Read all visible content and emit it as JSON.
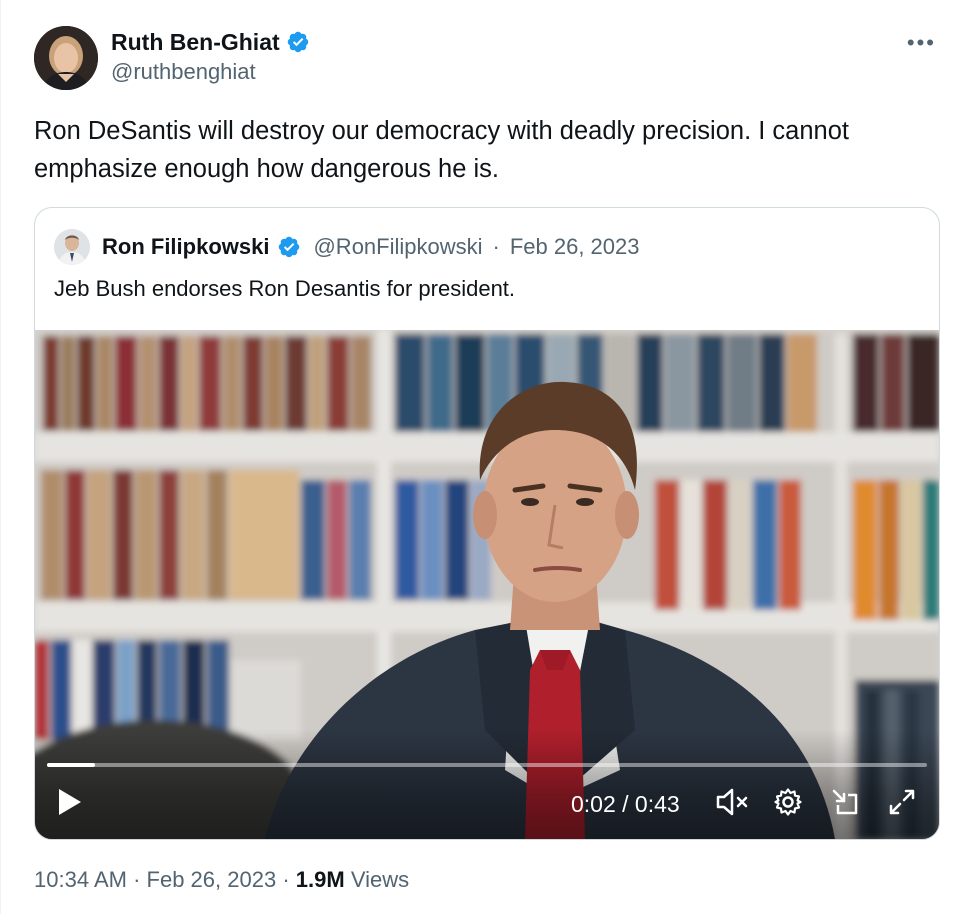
{
  "author": {
    "name": "Ruth Ben-Ghiat",
    "handle": "@ruthbenghiat",
    "verified": true
  },
  "more_label": "•••",
  "tweet_text": "Ron DeSantis will destroy our democracy with deadly precision. I cannot emphasize enough how dangerous he is.",
  "quoted": {
    "name": "Ron Filipkowski",
    "handle": "@RonFilipkowski",
    "separator": "·",
    "date": "Feb 26, 2023",
    "text": "Jeb Bush endorses Ron Desantis for president."
  },
  "video": {
    "time": "0:02 / 0:43",
    "progress": 0.055
  },
  "footer": {
    "time": "10:34 AM",
    "separator": "·",
    "date": "Feb 26, 2023",
    "views_count": "1.9M",
    "views_label": "Views"
  },
  "colors": {
    "verified": "#1d9bf0",
    "secondary_text": "#536471",
    "primary_text": "#0f1419"
  }
}
